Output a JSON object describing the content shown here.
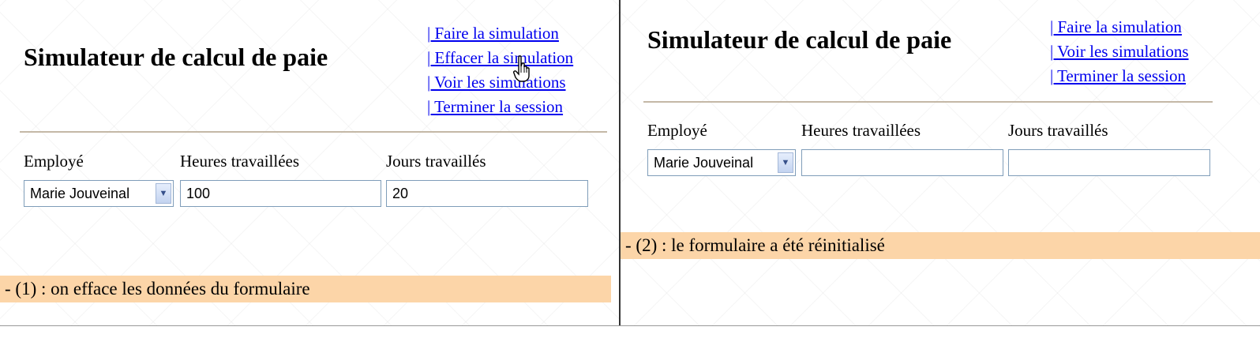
{
  "left_panel": {
    "title": "Simulateur de calcul de paie",
    "menu": [
      {
        "label": "| Faire la simulation"
      },
      {
        "label": "| Effacer la simulation"
      },
      {
        "label": "| Voir les simulations"
      },
      {
        "label": "| Terminer la session"
      }
    ],
    "form": {
      "employee_label": "Employé",
      "hours_label": "Heures travaillées",
      "days_label": "Jours travaillés",
      "employee_selected": "Marie Jouveinal",
      "hours_value": "100",
      "days_value": "20"
    },
    "caption": "- (1) : on efface les données du formulaire"
  },
  "right_panel": {
    "title": "Simulateur de calcul de paie",
    "menu": [
      {
        "label": "| Faire la simulation"
      },
      {
        "label": "| Voir les simulations"
      },
      {
        "label": "| Terminer la session"
      }
    ],
    "form": {
      "employee_label": "Employé",
      "hours_label": "Heures travaillées",
      "days_label": "Jours travaillés",
      "employee_selected": "Marie Jouveinal",
      "hours_value": "",
      "days_value": ""
    },
    "caption": "- (2) : le formulaire a été réinitialisé"
  },
  "icons": {
    "select_arrow": "chevron-down-icon",
    "cursor": "hand-pointer-icon"
  },
  "colors": {
    "link": "#0000ee",
    "caption_bg": "#fcd5a8",
    "input_border": "#7f9db9",
    "divider": "#c4b8a6"
  }
}
